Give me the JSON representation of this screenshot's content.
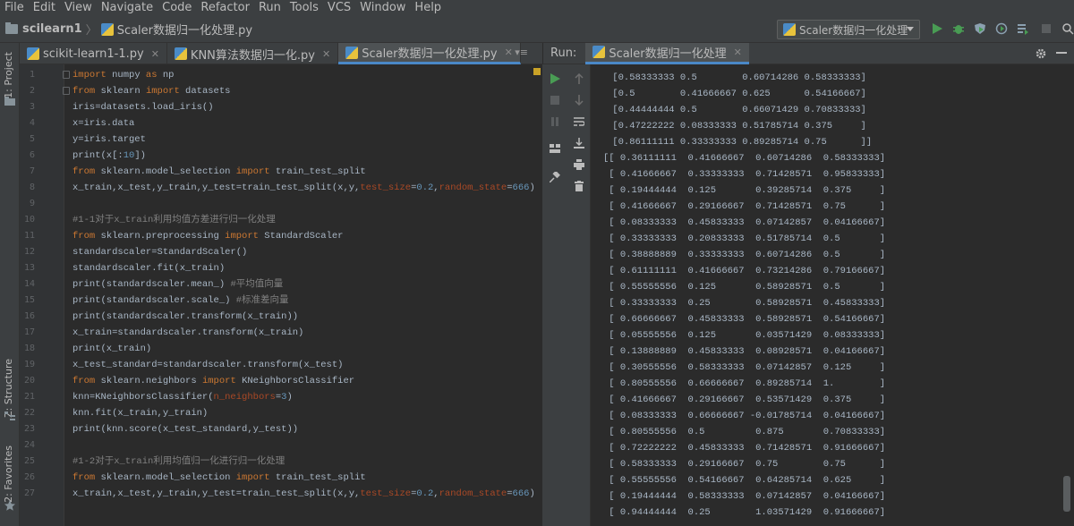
{
  "menu": [
    "File",
    "Edit",
    "View",
    "Navigate",
    "Code",
    "Refactor",
    "Run",
    "Tools",
    "VCS",
    "Window",
    "Help"
  ],
  "breadcrumb": {
    "project": "scilearn1",
    "file": "Scaler数据归一化处理.py"
  },
  "run_config": "Scaler数据归一化处理",
  "left_strip": {
    "project": "1: Project",
    "structure": "Z: Structure",
    "favorites": "2: Favorites"
  },
  "editor_tabs": [
    "scikit-learn1-1.py",
    "KNN算法数据归一化.py",
    "Scaler数据归一化处理.py"
  ],
  "editor_lines": [
    {
      "n": "1",
      "t": "import numpy as np"
    },
    {
      "n": "2",
      "t": "from sklearn import datasets"
    },
    {
      "n": "3",
      "t": "iris=datasets.load_iris()"
    },
    {
      "n": "4",
      "t": "x=iris.data"
    },
    {
      "n": "5",
      "t": "y=iris.target"
    },
    {
      "n": "6",
      "t": "print(x[:10])"
    },
    {
      "n": "7",
      "t": "from sklearn.model_selection import train_test_split"
    },
    {
      "n": "8",
      "t": "x_train,x_test,y_train,y_test=train_test_split(x,y,test_size=0.2,random_state=666)"
    },
    {
      "n": "9",
      "t": ""
    },
    {
      "n": "10",
      "t": "#1-1对于x_train利用均值方差进行归一化处理"
    },
    {
      "n": "11",
      "t": "from sklearn.preprocessing import StandardScaler"
    },
    {
      "n": "12",
      "t": "standardscaler=StandardScaler()"
    },
    {
      "n": "13",
      "t": "standardscaler.fit(x_train)"
    },
    {
      "n": "14",
      "t": "print(standardscaler.mean_) #平均值向量"
    },
    {
      "n": "15",
      "t": "print(standardscaler.scale_) #标准差向量"
    },
    {
      "n": "16",
      "t": "print(standardscaler.transform(x_train))"
    },
    {
      "n": "17",
      "t": "x_train=standardscaler.transform(x_train)"
    },
    {
      "n": "18",
      "t": "print(x_train)"
    },
    {
      "n": "19",
      "t": "x_test_standard=standardscaler.transform(x_test)"
    },
    {
      "n": "20",
      "t": "from sklearn.neighbors import KNeighborsClassifier"
    },
    {
      "n": "21",
      "t": "knn=KNeighborsClassifier(n_neighbors=3)"
    },
    {
      "n": "22",
      "t": "knn.fit(x_train,y_train)"
    },
    {
      "n": "23",
      "t": "print(knn.score(x_test_standard,y_test))"
    },
    {
      "n": "24",
      "t": ""
    },
    {
      "n": "25",
      "t": "#1-2对于x_train利用均值归一化进行归一化处理"
    },
    {
      "n": "26",
      "t": "from sklearn.model_selection import train_test_split"
    },
    {
      "n": "27",
      "t": "x_train,x_test,y_train,y_test=train_test_split(x,y,test_size=0.2,random_state=666)"
    }
  ],
  "run": {
    "label": "Run:",
    "tab": "Scaler数据归一化处理"
  },
  "console_lines": [
    " [0.58333333 0.5        0.60714286 0.58333333]",
    " [0.5        0.41666667 0.625      0.54166667]",
    " [0.44444444 0.5        0.66071429 0.70833333]",
    " [0.47222222 0.08333333 0.51785714 0.375     ]",
    " [0.86111111 0.33333333 0.89285714 0.75      ]]",
    "[[ 0.36111111  0.41666667  0.60714286  0.58333333]",
    " [ 0.41666667  0.33333333  0.71428571  0.95833333]",
    " [ 0.19444444  0.125       0.39285714  0.375     ]",
    " [ 0.41666667  0.29166667  0.71428571  0.75      ]",
    " [ 0.08333333  0.45833333  0.07142857  0.04166667]",
    " [ 0.33333333  0.20833333  0.51785714  0.5       ]",
    " [ 0.38888889  0.33333333  0.60714286  0.5       ]",
    " [ 0.61111111  0.41666667  0.73214286  0.79166667]",
    " [ 0.55555556  0.125       0.58928571  0.5       ]",
    " [ 0.33333333  0.25        0.58928571  0.45833333]",
    " [ 0.66666667  0.45833333  0.58928571  0.54166667]",
    " [ 0.05555556  0.125       0.03571429  0.08333333]",
    " [ 0.13888889  0.45833333  0.08928571  0.04166667]",
    " [ 0.30555556  0.58333333  0.07142857  0.125     ]",
    " [ 0.80555556  0.66666667  0.89285714  1.        ]",
    " [ 0.41666667  0.29166667  0.53571429  0.375     ]",
    " [ 0.08333333  0.66666667 -0.01785714  0.04166667]",
    " [ 0.80555556  0.5         0.875       0.70833333]",
    " [ 0.72222222  0.45833333  0.71428571  0.91666667]",
    " [ 0.58333333  0.29166667  0.75        0.75      ]",
    " [ 0.55555556  0.54166667  0.64285714  0.625     ]",
    " [ 0.19444444  0.58333333  0.07142857  0.04166667]",
    " [ 0.94444444  0.25        1.03571429  0.91666667]"
  ]
}
